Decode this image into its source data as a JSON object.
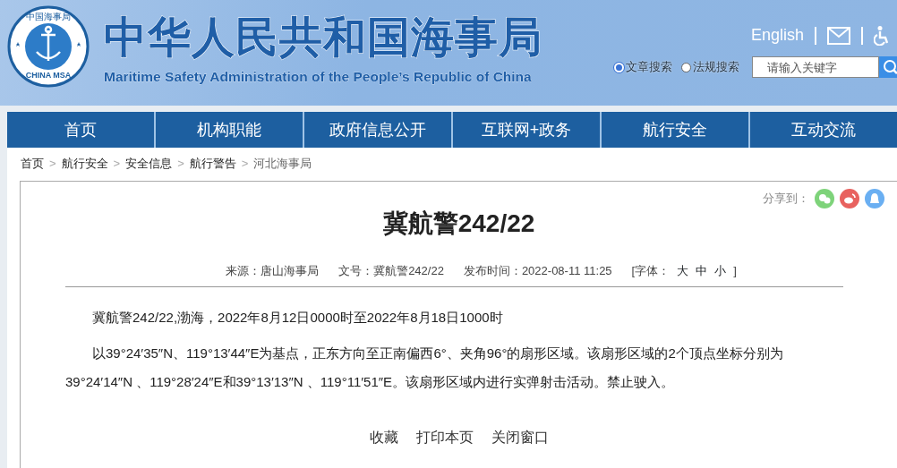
{
  "header": {
    "logo": {
      "top_text": "中国海事局",
      "bottom_text": "CHINA MSA"
    },
    "title": "中华人民共和国海事局",
    "subtitle": "Maritime Safety Administration of the People’s Republic of China",
    "language_link": "English"
  },
  "search": {
    "options": [
      {
        "label": "文章搜索",
        "selected": true
      },
      {
        "label": "法规搜索",
        "selected": false
      }
    ],
    "placeholder": "请输入关键字"
  },
  "nav": [
    "首页",
    "机构职能",
    "政府信息公开",
    "互联网+政务",
    "航行安全",
    "互动交流"
  ],
  "breadcrumb": [
    {
      "label": "首页"
    },
    {
      "separator": ">",
      "label": "航行安全"
    },
    {
      "separator": ">",
      "label": "安全信息"
    },
    {
      "separator": ">",
      "label": "航行警告"
    },
    {
      "separator": ">",
      "label": "河北海事局"
    }
  ],
  "article": {
    "share_label": "分享到：",
    "title": "冀航警242/22",
    "meta": [
      {
        "label": "来源：",
        "value": "唐山海事局"
      },
      {
        "label": "文号：",
        "value": "冀航警242/22"
      },
      {
        "label": "发布时间：",
        "value": "2022-08-11 11:25"
      }
    ],
    "font_size": {
      "open": "[字体：",
      "sizes": [
        "大",
        "中",
        "小"
      ],
      "close": "]"
    },
    "paragraphs": [
      "冀航警242/22,渤海，2022年8月12日0000时至2022年8月18日1000时",
      "以39°24′35″N、119°13′44″E为基点，正东方向至正南偏西6°、夹角96°的扇形区域。该扇形区域的2个顶点坐标分别为39°24′14″N 、119°28′24″E和39°13′13″N 、119°11′51″E。该扇形区域内进行实弹射击活动。禁止驶入。"
    ],
    "actions": [
      "收藏",
      "打印本页",
      "关闭窗口"
    ]
  }
}
